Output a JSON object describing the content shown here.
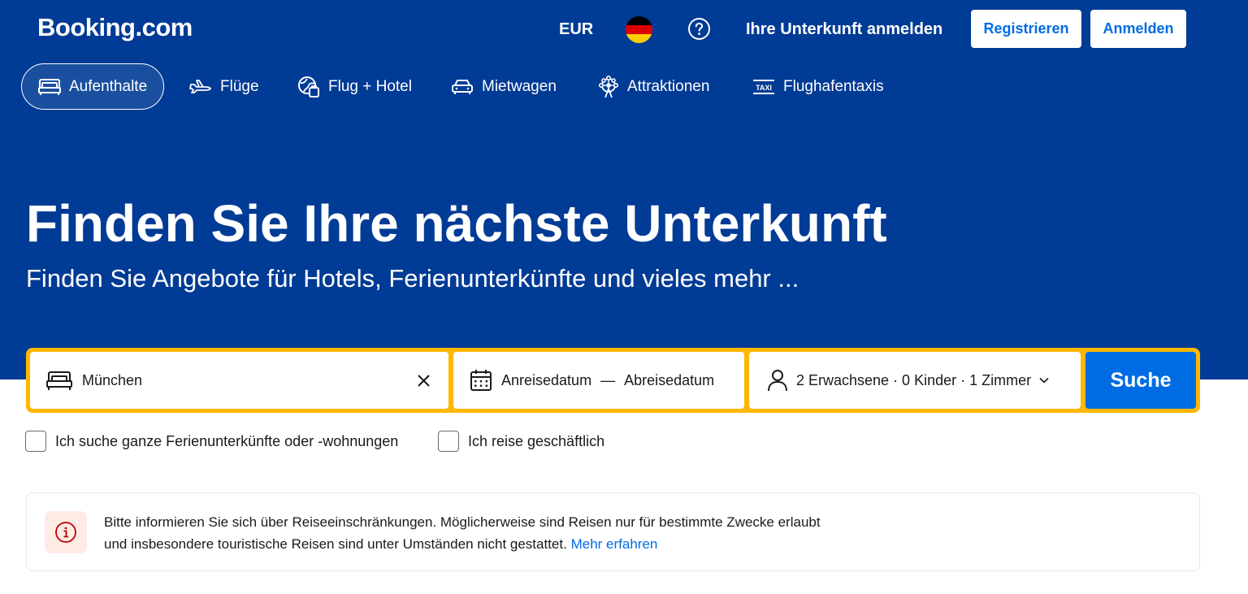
{
  "header": {
    "logo": "Booking.com",
    "currency": "EUR",
    "language_flag_icon": "german-flag-icon",
    "help_icon": "question-circle-icon",
    "list_property": "Ihre Unterkunft anmelden",
    "register": "Registrieren",
    "sign_in": "Anmelden"
  },
  "nav": {
    "tabs": [
      {
        "label": "Aufenthalte",
        "icon": "bed-icon",
        "active": true
      },
      {
        "label": "Flüge",
        "icon": "plane-icon",
        "active": false
      },
      {
        "label": "Flug + Hotel",
        "icon": "globe-suitcase-icon",
        "active": false
      },
      {
        "label": "Mietwagen",
        "icon": "car-icon",
        "active": false
      },
      {
        "label": "Attraktionen",
        "icon": "ferris-wheel-icon",
        "active": false
      },
      {
        "label": "Flughafentaxis",
        "icon": "taxi-icon",
        "active": false
      }
    ]
  },
  "hero": {
    "title": "Finden Sie Ihre nächste Unterkunft",
    "subtitle": "Finden Sie Angebote für Hotels, Ferienunterkünfte und vieles mehr ..."
  },
  "search": {
    "destination_value": "München",
    "checkin": "Anreisedatum",
    "separator": "—",
    "checkout": "Abreisedatum",
    "guests": "2 Erwachsene · 0 Kinder · 1 Zimmer",
    "button": "Suche"
  },
  "filters": {
    "whole_homes": "Ich suche ganze Ferienunterkünfte oder -wohnungen",
    "business": "Ich reise geschäftlich"
  },
  "notice": {
    "line1": "Bitte informieren Sie sich über Reiseeinschränkungen. Möglicherweise sind Reisen nur für bestimmte Zwecke erlaubt",
    "line2": "und insbesondere touristische Reisen sind unter Umständen nicht gestattet.",
    "link": "Mehr erfahren"
  },
  "colors": {
    "brand_blue": "#003b95",
    "action_blue": "#006ce4",
    "search_border": "#ffb700",
    "notice_icon_bg": "#fdebe6",
    "notice_icon_fg": "#c00000"
  }
}
